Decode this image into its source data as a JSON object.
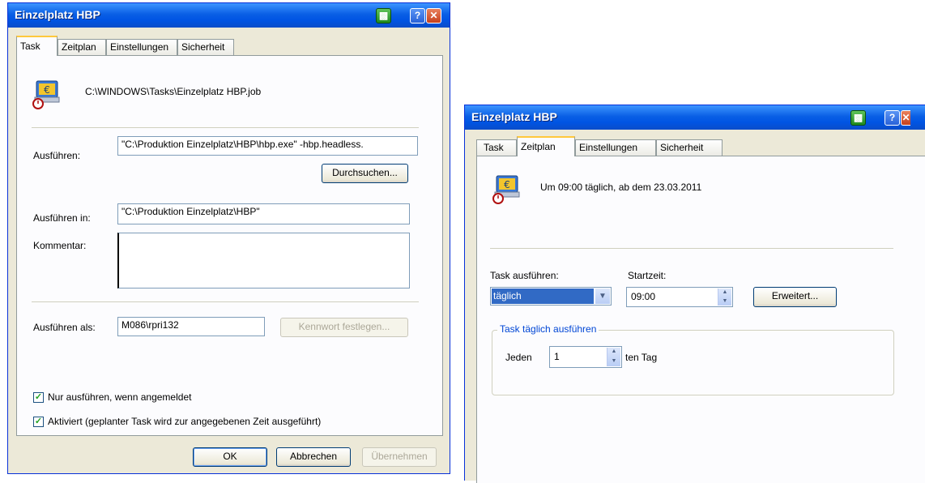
{
  "left_dialog": {
    "title": "Einzelplatz HBP",
    "tabs": [
      "Task",
      "Zeitplan",
      "Einstellungen",
      "Sicherheit"
    ],
    "active_tab": "Task",
    "job_path": "C:\\WINDOWS\\Tasks\\Einzelplatz HBP.job",
    "run_label": "Ausführen:",
    "run_value": "\"C:\\Produktion Einzelplatz\\HBP\\hbp.exe\" -hbp.headless.",
    "browse_label": "Durchsuchen...",
    "start_in_label": "Ausführen in:",
    "start_in_value": "\"C:\\Produktion Einzelplatz\\HBP\"",
    "comment_label": "Kommentar:",
    "comment_value": "",
    "run_as_label": "Ausführen als:",
    "run_as_value": "M086\\rpri132",
    "set_password_label": "Kennwort festlegen...",
    "only_if_logged_on_label": "Nur ausführen, wenn angemeldet",
    "only_if_logged_on_checked": true,
    "enabled_label": "Aktiviert (geplanter Task wird zur angegebenen Zeit ausgeführt)",
    "enabled_checked": true,
    "ok_label": "OK",
    "cancel_label": "Abbrechen",
    "apply_label": "Übernehmen"
  },
  "right_dialog": {
    "title": "Einzelplatz HBP",
    "tabs": [
      "Task",
      "Zeitplan",
      "Einstellungen",
      "Sicherheit"
    ],
    "active_tab": "Zeitplan",
    "schedule_summary": "Um 09:00 täglich, ab dem 23.03.2011",
    "schedule_task_label": "Task ausführen:",
    "schedule_task_value": "täglich",
    "start_time_label": "Startzeit:",
    "start_time_value": "09:00",
    "advanced_label": "Erweitert...",
    "group_title": "Task täglich ausführen",
    "every_label": "Jeden",
    "every_value": "1",
    "day_suffix_label": "ten Tag"
  },
  "colors": {
    "titlebar": "#0054e3",
    "window_bg": "#ece9d8",
    "selection": "#316ac5",
    "group_title": "#0046d5"
  }
}
